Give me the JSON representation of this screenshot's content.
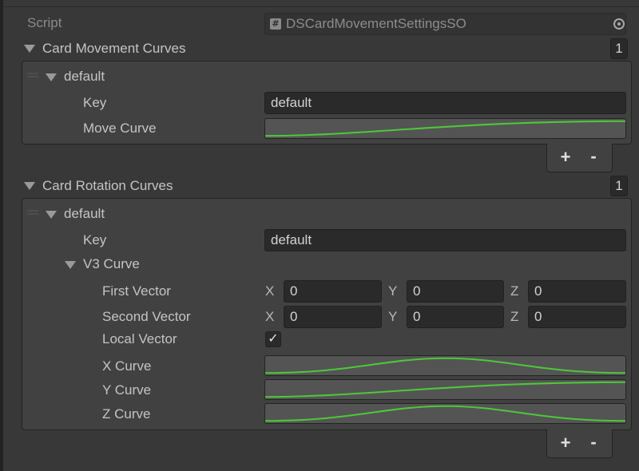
{
  "script": {
    "label": "Script",
    "value": "DSCardMovementSettingsSO",
    "type_icon": "csharp-script-icon",
    "picker_icon": "object-picker-icon"
  },
  "movement": {
    "title": "Card Movement Curves",
    "count": "1",
    "element": {
      "name": "default",
      "key_label": "Key",
      "key_value": "default",
      "move_curve_label": "Move Curve"
    },
    "add_label": "+",
    "remove_label": "-"
  },
  "rotation": {
    "title": "Card Rotation Curves",
    "count": "1",
    "element": {
      "name": "default",
      "key_label": "Key",
      "key_value": "default",
      "v3_label": "V3 Curve",
      "first_vector": {
        "label": "First Vector",
        "x": "0",
        "y": "0",
        "z": "0"
      },
      "second_vector": {
        "label": "Second Vector",
        "x": "0",
        "y": "0",
        "z": "0"
      },
      "axis_labels": {
        "x": "X",
        "y": "Y",
        "z": "Z"
      },
      "local_vector": {
        "label": "Local Vector",
        "checked": true,
        "mark": "✓"
      },
      "x_curve_label": "X Curve",
      "y_curve_label": "Y Curve",
      "z_curve_label": "Z Curve"
    },
    "add_label": "+",
    "remove_label": "-"
  },
  "colors": {
    "curve_line": "#4ec73a",
    "field_bg": "#2a2a2a",
    "panel_bg": "#414141",
    "background": "#383838"
  }
}
